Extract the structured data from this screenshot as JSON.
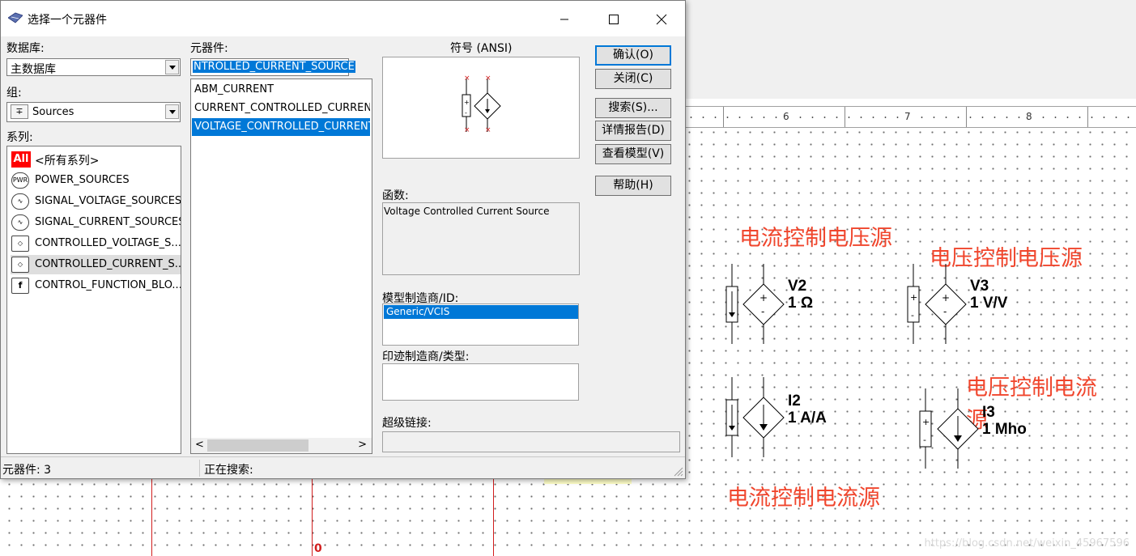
{
  "dialog": {
    "title": "选择一个元器件",
    "database_label": "数据库:",
    "database_value": "主数据库",
    "group_label": "组:",
    "group_value": "Sources",
    "family_label": "系列:",
    "families": [
      {
        "icon": "all-badge-icon",
        "badge": "All",
        "label": "<所有系列>"
      },
      {
        "icon": "power-sources-icon",
        "badge": "PWR",
        "label": "POWER_SOURCES"
      },
      {
        "icon": "signal-voltage-sources-icon",
        "badge": "",
        "label": "SIGNAL_VOLTAGE_SOURCES"
      },
      {
        "icon": "signal-current-sources-icon",
        "badge": "",
        "label": "SIGNAL_CURRENT_SOURCES"
      },
      {
        "icon": "controlled-voltage-sources-icon",
        "badge": "",
        "label": "CONTROLLED_VOLTAGE_S..."
      },
      {
        "icon": "controlled-current-sources-icon",
        "badge": "",
        "label": "CONTROLLED_CURRENT_S..."
      },
      {
        "icon": "control-function-blocks-icon",
        "badge": "f",
        "label": "CONTROL_FUNCTION_BLO..."
      }
    ],
    "component_label": "元器件:",
    "component_search_value": "NTROLLED_CURRENT_SOURCE",
    "components": [
      "ABM_CURRENT",
      "CURRENT_CONTROLLED_CURRENT_",
      "VOLTAGE_CONTROLLED_CURRENT_"
    ],
    "selected_component_index": 2,
    "symbol_label": "符号 (ANSI)",
    "function_label": "函数:",
    "function_text": "Voltage Controlled Current Source",
    "model_label": "模型制造商/ID:",
    "model_items": [
      "Generic/VCIS"
    ],
    "footprint_label": "印迹制造商/类型:",
    "hyperlink_label": "超级链接:",
    "buttons": {
      "ok": "确认(O)",
      "close": "关闭(C)",
      "search": "搜索(S)...",
      "detail_report": "详情报告(D)",
      "view_model": "查看模型(V)",
      "help": "帮助(H)"
    },
    "status": {
      "component_count": "元器件: 3",
      "searching": "正在搜索:"
    }
  },
  "schematic": {
    "ruler_numbers": [
      "6",
      "7",
      "8"
    ],
    "annotations": {
      "ccvs": "电流控制电压源",
      "vcvs": "电压控制电压源",
      "vccs": "电压控制电流",
      "vccs_cont": "源",
      "cccs": "电流控制电流源"
    },
    "parts": [
      {
        "ref": "V2",
        "value": "1 Ω"
      },
      {
        "ref": "V3",
        "value": "1 V/V"
      },
      {
        "ref": "I2",
        "value": "1 A/A"
      },
      {
        "ref": "I3",
        "value": "1 Mho"
      }
    ],
    "bottom_label": "0",
    "watermark": "https://blog.csdn.net/weixin_45967596"
  },
  "colors": {
    "annotation_red": "#f0462d",
    "selection_blue": "#0078d7",
    "wire_red": "#d21e1e"
  }
}
